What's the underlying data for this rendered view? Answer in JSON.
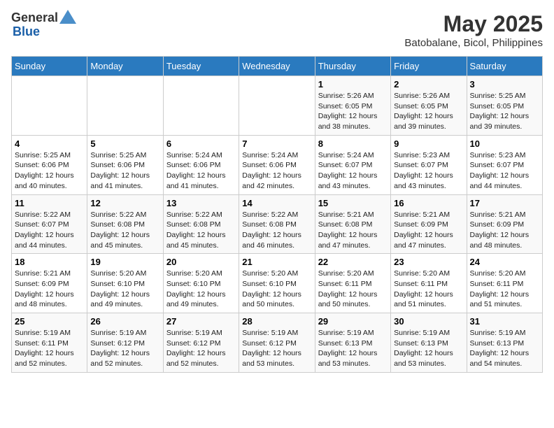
{
  "header": {
    "logo_general": "General",
    "logo_blue": "Blue",
    "month_year": "May 2025",
    "location": "Batobalane, Bicol, Philippines"
  },
  "days_of_week": [
    "Sunday",
    "Monday",
    "Tuesday",
    "Wednesday",
    "Thursday",
    "Friday",
    "Saturday"
  ],
  "weeks": [
    [
      {
        "day": "",
        "info": ""
      },
      {
        "day": "",
        "info": ""
      },
      {
        "day": "",
        "info": ""
      },
      {
        "day": "",
        "info": ""
      },
      {
        "day": "1",
        "info": "Sunrise: 5:26 AM\nSunset: 6:05 PM\nDaylight: 12 hours\nand 38 minutes."
      },
      {
        "day": "2",
        "info": "Sunrise: 5:26 AM\nSunset: 6:05 PM\nDaylight: 12 hours\nand 39 minutes."
      },
      {
        "day": "3",
        "info": "Sunrise: 5:25 AM\nSunset: 6:05 PM\nDaylight: 12 hours\nand 39 minutes."
      }
    ],
    [
      {
        "day": "4",
        "info": "Sunrise: 5:25 AM\nSunset: 6:06 PM\nDaylight: 12 hours\nand 40 minutes."
      },
      {
        "day": "5",
        "info": "Sunrise: 5:25 AM\nSunset: 6:06 PM\nDaylight: 12 hours\nand 41 minutes."
      },
      {
        "day": "6",
        "info": "Sunrise: 5:24 AM\nSunset: 6:06 PM\nDaylight: 12 hours\nand 41 minutes."
      },
      {
        "day": "7",
        "info": "Sunrise: 5:24 AM\nSunset: 6:06 PM\nDaylight: 12 hours\nand 42 minutes."
      },
      {
        "day": "8",
        "info": "Sunrise: 5:24 AM\nSunset: 6:07 PM\nDaylight: 12 hours\nand 43 minutes."
      },
      {
        "day": "9",
        "info": "Sunrise: 5:23 AM\nSunset: 6:07 PM\nDaylight: 12 hours\nand 43 minutes."
      },
      {
        "day": "10",
        "info": "Sunrise: 5:23 AM\nSunset: 6:07 PM\nDaylight: 12 hours\nand 44 minutes."
      }
    ],
    [
      {
        "day": "11",
        "info": "Sunrise: 5:22 AM\nSunset: 6:07 PM\nDaylight: 12 hours\nand 44 minutes."
      },
      {
        "day": "12",
        "info": "Sunrise: 5:22 AM\nSunset: 6:08 PM\nDaylight: 12 hours\nand 45 minutes."
      },
      {
        "day": "13",
        "info": "Sunrise: 5:22 AM\nSunset: 6:08 PM\nDaylight: 12 hours\nand 45 minutes."
      },
      {
        "day": "14",
        "info": "Sunrise: 5:22 AM\nSunset: 6:08 PM\nDaylight: 12 hours\nand 46 minutes."
      },
      {
        "day": "15",
        "info": "Sunrise: 5:21 AM\nSunset: 6:08 PM\nDaylight: 12 hours\nand 47 minutes."
      },
      {
        "day": "16",
        "info": "Sunrise: 5:21 AM\nSunset: 6:09 PM\nDaylight: 12 hours\nand 47 minutes."
      },
      {
        "day": "17",
        "info": "Sunrise: 5:21 AM\nSunset: 6:09 PM\nDaylight: 12 hours\nand 48 minutes."
      }
    ],
    [
      {
        "day": "18",
        "info": "Sunrise: 5:21 AM\nSunset: 6:09 PM\nDaylight: 12 hours\nand 48 minutes."
      },
      {
        "day": "19",
        "info": "Sunrise: 5:20 AM\nSunset: 6:10 PM\nDaylight: 12 hours\nand 49 minutes."
      },
      {
        "day": "20",
        "info": "Sunrise: 5:20 AM\nSunset: 6:10 PM\nDaylight: 12 hours\nand 49 minutes."
      },
      {
        "day": "21",
        "info": "Sunrise: 5:20 AM\nSunset: 6:10 PM\nDaylight: 12 hours\nand 50 minutes."
      },
      {
        "day": "22",
        "info": "Sunrise: 5:20 AM\nSunset: 6:11 PM\nDaylight: 12 hours\nand 50 minutes."
      },
      {
        "day": "23",
        "info": "Sunrise: 5:20 AM\nSunset: 6:11 PM\nDaylight: 12 hours\nand 51 minutes."
      },
      {
        "day": "24",
        "info": "Sunrise: 5:20 AM\nSunset: 6:11 PM\nDaylight: 12 hours\nand 51 minutes."
      }
    ],
    [
      {
        "day": "25",
        "info": "Sunrise: 5:19 AM\nSunset: 6:11 PM\nDaylight: 12 hours\nand 52 minutes."
      },
      {
        "day": "26",
        "info": "Sunrise: 5:19 AM\nSunset: 6:12 PM\nDaylight: 12 hours\nand 52 minutes."
      },
      {
        "day": "27",
        "info": "Sunrise: 5:19 AM\nSunset: 6:12 PM\nDaylight: 12 hours\nand 52 minutes."
      },
      {
        "day": "28",
        "info": "Sunrise: 5:19 AM\nSunset: 6:12 PM\nDaylight: 12 hours\nand 53 minutes."
      },
      {
        "day": "29",
        "info": "Sunrise: 5:19 AM\nSunset: 6:13 PM\nDaylight: 12 hours\nand 53 minutes."
      },
      {
        "day": "30",
        "info": "Sunrise: 5:19 AM\nSunset: 6:13 PM\nDaylight: 12 hours\nand 53 minutes."
      },
      {
        "day": "31",
        "info": "Sunrise: 5:19 AM\nSunset: 6:13 PM\nDaylight: 12 hours\nand 54 minutes."
      }
    ]
  ]
}
